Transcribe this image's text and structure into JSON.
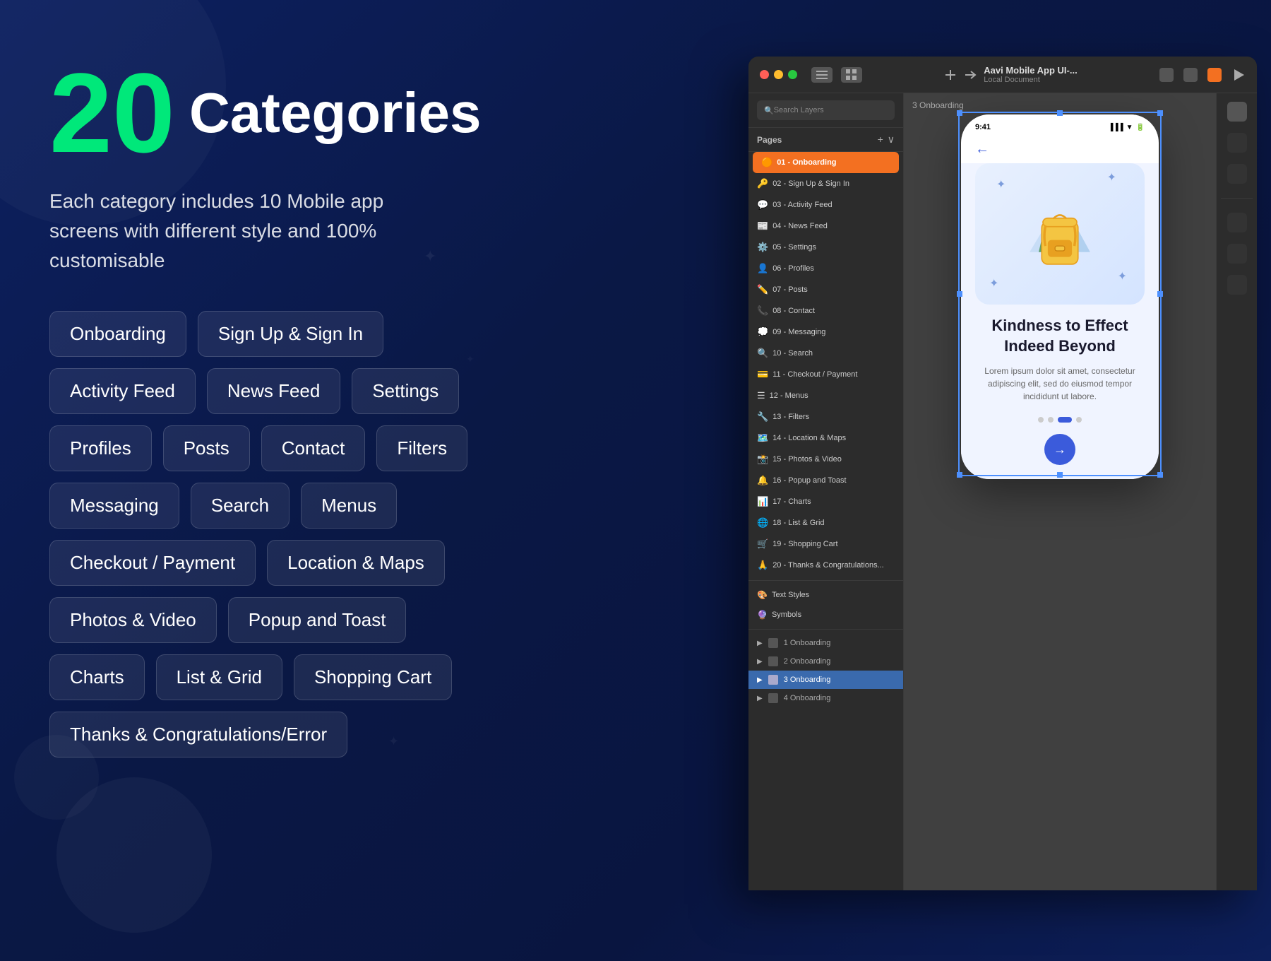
{
  "background": {
    "color": "#0a1845"
  },
  "hero": {
    "number": "20",
    "categories_label": "Categories",
    "subtitle": "Each category includes 10 Mobile app screens with different style and 100% customisable"
  },
  "tags": {
    "rows": [
      [
        "Onboarding",
        "Sign Up & Sign In"
      ],
      [
        "Activity Feed",
        "News Feed",
        "Settings"
      ],
      [
        "Profiles",
        "Posts",
        "Contact",
        "Filters"
      ],
      [
        "Messaging",
        "Search",
        "Menus"
      ],
      [
        "Checkout / Payment",
        "Location & Maps"
      ],
      [
        "Photos & Video",
        "Popup and Toast"
      ],
      [
        "Charts",
        "List & Grid",
        "Shopping Cart"
      ],
      [
        "Thanks & Congratulations/Error"
      ]
    ]
  },
  "figma_window": {
    "title": "Aavi Mobile App UI-...",
    "subtitle": "Local Document",
    "search_placeholder": "Search Layers",
    "pages_label": "Pages",
    "pages": [
      {
        "number": "01 -",
        "emoji": "🟠",
        "label": "Onboarding",
        "active": true
      },
      {
        "number": "02 -",
        "emoji": "🔑",
        "label": "Sign Up & Sign In",
        "active": false
      },
      {
        "number": "03 -",
        "emoji": "💬",
        "label": "Activity Feed",
        "active": false
      },
      {
        "number": "04 -",
        "emoji": "📰",
        "label": "News Feed",
        "active": false
      },
      {
        "number": "05 -",
        "emoji": "⚙️",
        "label": "Settings",
        "active": false
      },
      {
        "number": "06 -",
        "emoji": "👤",
        "label": "Profiles",
        "active": false
      },
      {
        "number": "07 -",
        "emoji": "✏️",
        "label": "Posts",
        "active": false
      },
      {
        "number": "08 -",
        "emoji": "📞",
        "label": "Contact",
        "active": false
      },
      {
        "number": "09 -",
        "emoji": "💭",
        "label": "Messaging",
        "active": false
      },
      {
        "number": "10 -",
        "emoji": "🔍",
        "label": "Search",
        "active": false
      },
      {
        "number": "11 -",
        "emoji": "💳",
        "label": "Checkout / Payment",
        "active": false
      },
      {
        "number": "12 -",
        "emoji": "☰",
        "label": "Menus",
        "active": false
      },
      {
        "number": "13 -",
        "emoji": "🔧",
        "label": "Filters",
        "active": false
      },
      {
        "number": "14 -",
        "emoji": "🗺️",
        "label": "Location & Maps",
        "active": false
      },
      {
        "number": "15 -",
        "emoji": "📸",
        "label": "Photos & Video",
        "active": false
      },
      {
        "number": "16 -",
        "emoji": "🔔",
        "label": "Popup and Toast",
        "active": false
      },
      {
        "number": "17 -",
        "emoji": "📊",
        "label": "Charts",
        "active": false
      },
      {
        "number": "18 -",
        "emoji": "🌐",
        "label": "List & Grid",
        "active": false
      },
      {
        "number": "19 -",
        "emoji": "🛒",
        "label": "Shopping Cart",
        "active": false
      },
      {
        "number": "20 -",
        "emoji": "🙏",
        "label": "Thanks & Congratulations...",
        "active": false
      }
    ],
    "special_items": [
      {
        "emoji": "🎨",
        "label": "Text Styles"
      },
      {
        "emoji": "🔮",
        "label": "Symbols"
      }
    ],
    "layers": [
      {
        "label": "1 Onboarding",
        "active": false
      },
      {
        "label": "2 Onboarding",
        "active": false
      },
      {
        "label": "3 Onboarding",
        "active": true
      },
      {
        "label": "4 Onboarding",
        "active": false
      }
    ],
    "canvas_label": "3 Onboarding",
    "phone": {
      "time": "9:41",
      "heading": "Kindness to Effect Indeed Beyond",
      "body": "Lorem ipsum dolor sit amet, consectetur adipiscing elit, sed do eiusmod tempor incididunt ut labore."
    }
  }
}
